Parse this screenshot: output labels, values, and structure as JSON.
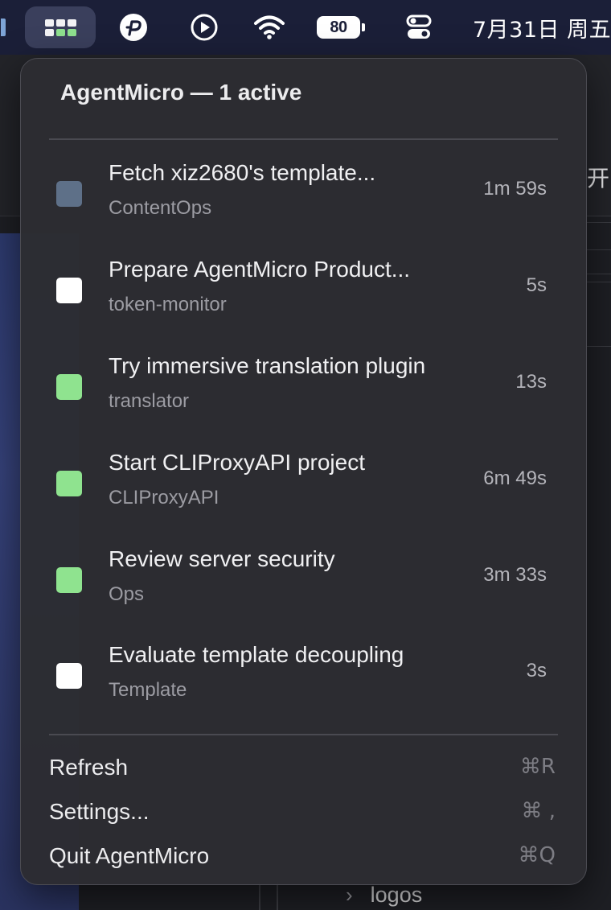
{
  "menubar": {
    "battery_percent": "80",
    "clock": "7月31日 周五",
    "icons": [
      "app-grid-icon",
      "p-logo-icon",
      "play-circle-icon",
      "wifi-icon",
      "battery-icon",
      "control-center-icon"
    ]
  },
  "background": {
    "right_text": "开",
    "bottom_row": {
      "chevron": "›",
      "label": "logos"
    }
  },
  "menu": {
    "header": "AgentMicro — 1 active",
    "tasks": [
      {
        "title": "Fetch xiz2680's template...",
        "subtitle": "ContentOps",
        "time": "1m 59s",
        "status_color": "#5e7088"
      },
      {
        "title": "Prepare AgentMicro Product...",
        "subtitle": "token-monitor",
        "time": "5s",
        "status_color": "#ffffff"
      },
      {
        "title": "Try immersive translation plugin",
        "subtitle": "translator",
        "time": "13s",
        "status_color": "#8fe38f"
      },
      {
        "title": "Start CLIProxyAPI project",
        "subtitle": "CLIProxyAPI",
        "time": "6m 49s",
        "status_color": "#8fe38f"
      },
      {
        "title": "Review server security",
        "subtitle": "Ops",
        "time": "3m 33s",
        "status_color": "#8fe38f"
      },
      {
        "title": "Evaluate template decoupling",
        "subtitle": "Template",
        "time": "3s",
        "status_color": "#ffffff"
      }
    ],
    "actions": [
      {
        "label": "Refresh",
        "shortcut": "⌘R"
      },
      {
        "label": "Settings...",
        "shortcut": "⌘ ,"
      },
      {
        "label": "Quit AgentMicro",
        "shortcut": "⌘Q"
      }
    ]
  },
  "colors": {
    "accent_green": "#8fe38f",
    "menu_bg": "#2c2c32",
    "menubar_bg": "#1b1f38"
  }
}
